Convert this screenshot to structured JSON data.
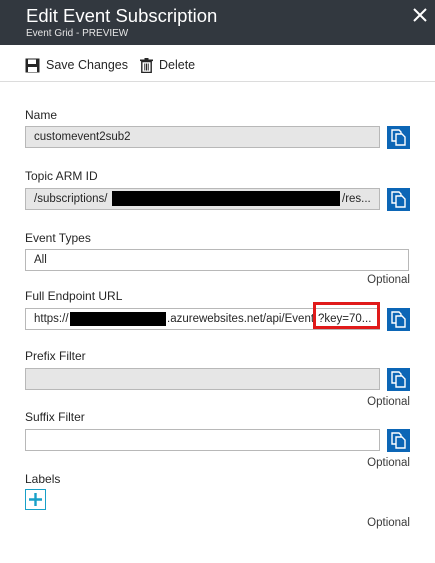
{
  "header": {
    "title": "Edit Event Subscription",
    "subtitle": "Event Grid - PREVIEW",
    "close_icon": "close-icon"
  },
  "toolbar": {
    "save_label": "Save Changes",
    "delete_label": "Delete",
    "save_icon": "save-icon",
    "delete_icon": "trash-icon"
  },
  "fields": {
    "name": {
      "label": "Name",
      "value": "customevent2sub2"
    },
    "topic": {
      "label": "Topic ARM ID",
      "value_prefix": "/subscriptions/",
      "value_suffix": "/res..."
    },
    "event_types": {
      "label": "Event Types",
      "value": "All",
      "optional": "Optional"
    },
    "endpoint": {
      "label": "Full Endpoint URL",
      "value_prefix": "https://",
      "value_middle": ".azurewebsites.net/api/Event",
      "value_highlight": "?key=70..."
    },
    "prefix": {
      "label": "Prefix Filter",
      "value": "",
      "optional": "Optional"
    },
    "suffix": {
      "label": "Suffix Filter",
      "value": "",
      "optional": "Optional"
    },
    "labels": {
      "label": "Labels",
      "optional": "Optional",
      "add_icon": "plus-icon"
    }
  },
  "colors": {
    "header_bg": "#32383f",
    "copy_button": "#0c66b6",
    "highlight": "#e01a1a",
    "readonly_bg": "#e6e6e6",
    "add_border": "#18a0c8"
  }
}
